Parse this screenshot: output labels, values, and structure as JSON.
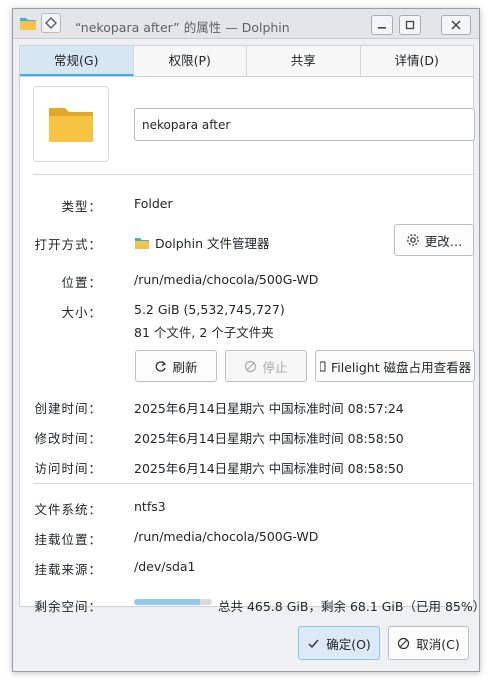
{
  "window": {
    "title": "“nekopara after” 的属性 — Dolphin"
  },
  "tabs": [
    {
      "label": "常规(G)"
    },
    {
      "label": "权限(P)"
    },
    {
      "label": "共享"
    },
    {
      "label": "详情(D)"
    }
  ],
  "general": {
    "name_value": "nekopara after",
    "type_label": "类型：",
    "type_value": "Folder",
    "open_with_label": "打开方式：",
    "open_with_value": "Dolphin 文件管理器",
    "change_button": "更改…",
    "location_label": "位置：",
    "location_value": "/run/media/chocola/500G-WD",
    "size_label": "大小：",
    "size_value": "5.2 GiB (5,532,745,727)",
    "size_detail": "81 个文件, 2 个子文件夹",
    "refresh_button": "刷新",
    "stop_button": "停止",
    "filelight_button": "Filelight 磁盘占用查看器",
    "created_label": "创建时间：",
    "created_value": "2025年6月14日星期六 中国标准时间 08:57:24",
    "modified_label": "修改时间：",
    "modified_value": "2025年6月14日星期六 中国标准时间 08:58:50",
    "accessed_label": "访问时间：",
    "accessed_value": "2025年6月14日星期六 中国标准时间 08:58:50",
    "filesystem_label": "文件系统：",
    "filesystem_value": "ntfs3",
    "mount_point_label": "挂载位置：",
    "mount_point_value": "/run/media/chocola/500G-WD",
    "mount_source_label": "挂载来源：",
    "mount_source_value": "/dev/sda1",
    "free_space_label": "剩余空间：",
    "free_space_value": "总共 465.8 GiB，剩余 68.1 GiB（已用 85%）",
    "used_fraction": 0.85
  },
  "footer": {
    "ok_button": "确定(O)",
    "cancel_button": "取消(C)"
  },
  "colors": {
    "accent": "#3daee9",
    "folder": "#f6c342",
    "folder_dark": "#e0a92a"
  }
}
